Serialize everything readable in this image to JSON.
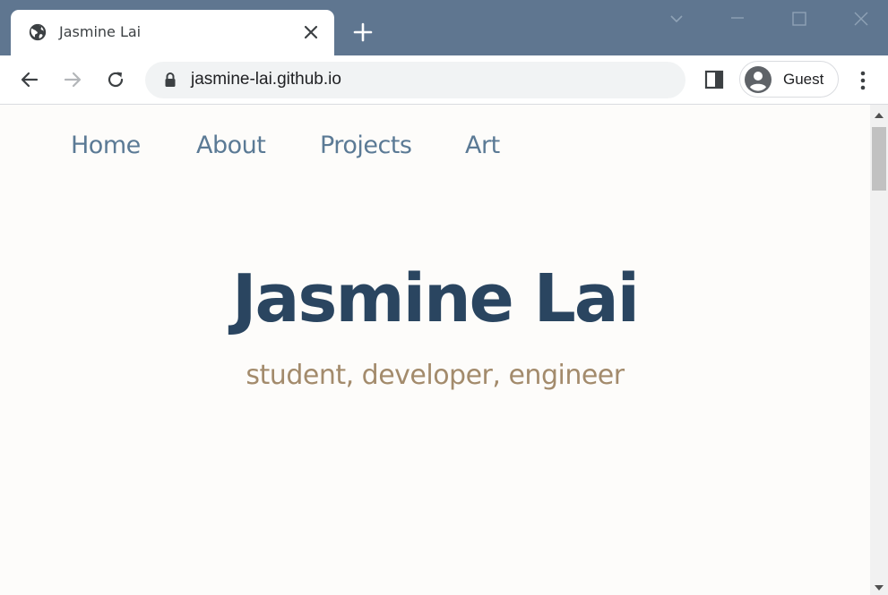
{
  "browser": {
    "tab": {
      "title": "Jasmine Lai",
      "favicon": "globe-icon"
    },
    "address_bar": {
      "url": "jasmine-lai.github.io",
      "secure_icon": "lock-icon"
    },
    "profile": {
      "label": "Guest",
      "icon": "account-circle-icon"
    },
    "colors": {
      "frame": "#5f7690",
      "toolbar": "#ffffff",
      "omnibox": "#f1f3f4"
    }
  },
  "page": {
    "nav": [
      {
        "label": "Home"
      },
      {
        "label": "About"
      },
      {
        "label": "Projects"
      },
      {
        "label": "Art"
      }
    ],
    "hero": {
      "title": "Jasmine Lai",
      "subtitle": "student, developer, engineer"
    },
    "colors": {
      "background": "#fdfcfa",
      "nav": "#5b7a95",
      "title": "#2a4560",
      "subtitle": "#a38b6c"
    }
  }
}
